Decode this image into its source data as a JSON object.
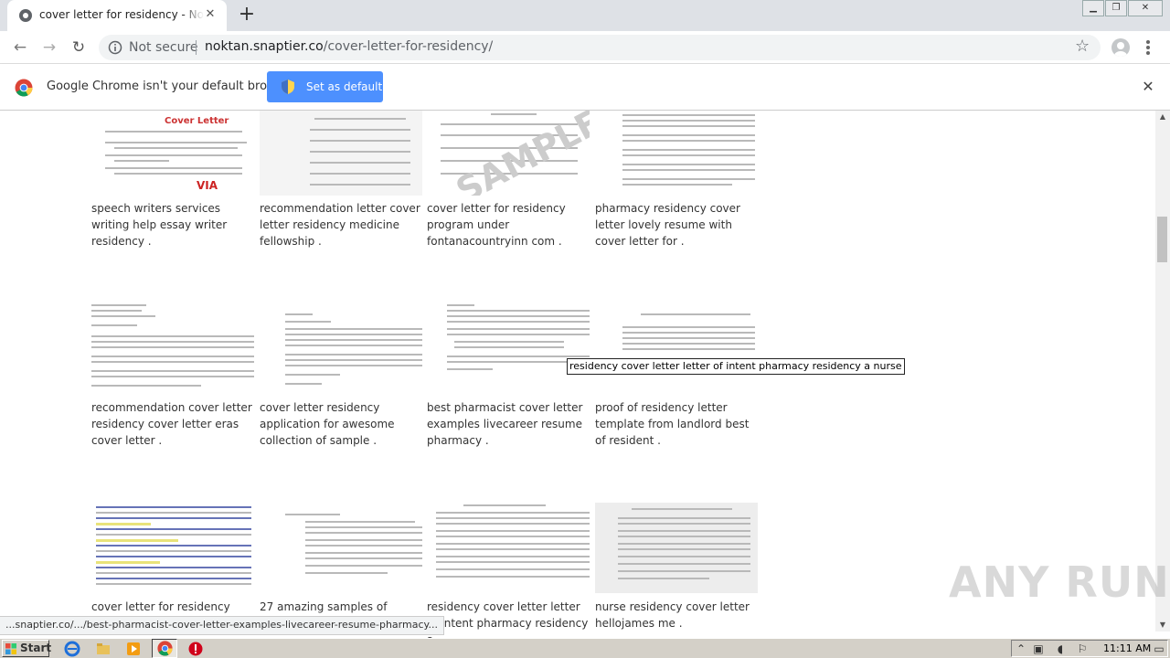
{
  "browser": {
    "tab": {
      "title": "cover letter for residency - Noktan.snaptier.co",
      "favicon": "chrome-globe-icon"
    },
    "omnibox": {
      "security_label": "Not secure",
      "url_host": "noktan.snaptier.co",
      "url_path": "/cover-letter-for-residency/"
    },
    "infobar": {
      "message": "Google Chrome isn't your default browser",
      "button_label": "Set as default",
      "button_color": "#4d90fe"
    }
  },
  "gallery": {
    "rows": [
      [
        {
          "caption": "speech writers services writing help essay writer residency ."
        },
        {
          "caption": "recommendation letter cover letter residency medicine fellowship ."
        },
        {
          "caption": "cover letter for residency program under fontanacountryinn com ."
        },
        {
          "caption": "pharmacy residency cover letter lovely resume with cover letter for ."
        }
      ],
      [
        {
          "caption": "recommendation cover letter residency cover letter eras cover letter ."
        },
        {
          "caption": "cover letter residency application for awesome collection of sample ."
        },
        {
          "caption": "best pharmacist cover letter examples livecareer resume pharmacy ."
        },
        {
          "caption": "proof of residency letter template from landlord best of resident ."
        }
      ],
      [
        {
          "caption": "cover letter for residency"
        },
        {
          "caption": "27 amazing samples of"
        },
        {
          "caption": "residency cover letter letter of intent pharmacy residency a"
        },
        {
          "caption": "nurse residency cover letter hellojames me ."
        }
      ]
    ],
    "thumb1": {
      "heading": "Cover Letter",
      "badge": "VIA"
    },
    "thumb3_watermark": "SAMPLE",
    "hidden_caption_tail": "ent"
  },
  "tooltip": "residency cover letter letter of intent pharmacy residency a nurse",
  "status_bar": "...snaptier.co/.../best-pharmacist-cover-letter-examples-livecareer-resume-pharmacy...",
  "watermark": "ANY RUN",
  "taskbar": {
    "start_label": "Start",
    "clock": "11:11 AM",
    "apps": [
      "ie-icon",
      "folder-icon",
      "media-player-icon",
      "chrome-icon",
      "stop-icon"
    ]
  }
}
